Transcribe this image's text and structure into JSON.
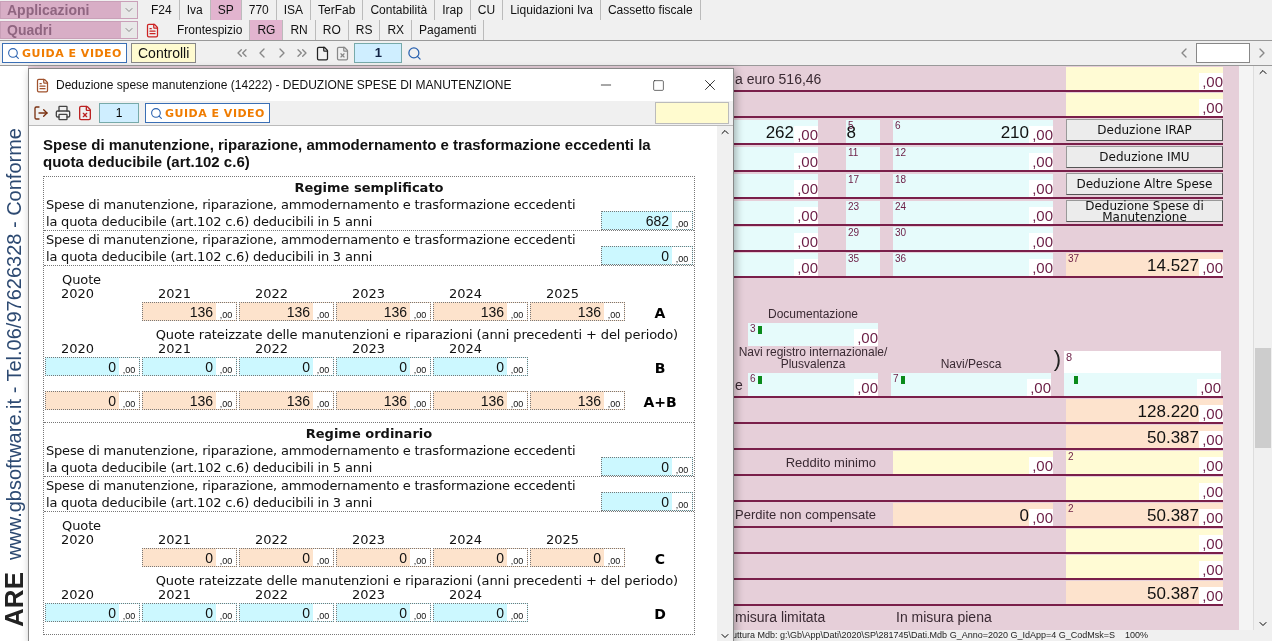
{
  "menu": {
    "apps_label": "Applicazioni",
    "apps_tabs": [
      {
        "label": "F24",
        "selected": false
      },
      {
        "label": "Iva",
        "selected": false
      },
      {
        "label": "SP",
        "selected": true
      },
      {
        "label": "770",
        "selected": false
      },
      {
        "label": "ISA",
        "selected": false
      },
      {
        "label": "TerFab",
        "selected": false
      },
      {
        "label": "Contabilità",
        "selected": false
      },
      {
        "label": "Irap",
        "selected": false
      },
      {
        "label": "CU",
        "selected": false
      },
      {
        "label": "Liquidazioni Iva",
        "selected": false
      },
      {
        "label": "Cassetto fiscale",
        "selected": false
      }
    ],
    "sheets_label": "Quadri",
    "sheet_tabs": [
      {
        "label": "Frontespizio",
        "selected": false
      },
      {
        "label": "RG",
        "selected": true
      },
      {
        "label": "RN",
        "selected": false
      },
      {
        "label": "RO",
        "selected": false
      },
      {
        "label": "RS",
        "selected": false
      },
      {
        "label": "RX",
        "selected": false
      },
      {
        "label": "Pagamenti",
        "selected": false
      }
    ]
  },
  "toolbar": {
    "guide": "GUIDA E VIDEO",
    "controls": "Controlli",
    "page": "1"
  },
  "side_strip": {
    "text": "www.gbsoftware.it - Tel.06/97626328 - Conforme",
    "logo": "ARE"
  },
  "form": {
    "upper_rows": [
      {
        "cells": [
          {
            "kind": "text",
            "text": "a euro 516,46"
          },
          "",
          "",
          {
            "kind": "note",
            "cents": ",00"
          }
        ]
      },
      {
        "cells": [
          "",
          "",
          "",
          {
            "kind": "note",
            "cents": ",00"
          }
        ]
      },
      {
        "cells": [
          {
            "kind": "input",
            "value": "262",
            "cents": ",00"
          },
          {
            "kind": "input",
            "tag": "5",
            "value": "8"
          },
          {
            "kind": "input",
            "tag": "6",
            "value": "210",
            "cents": ",00"
          },
          {
            "kind": "button",
            "text": "Deduzione IRAP"
          }
        ]
      },
      {
        "cells": [
          {
            "kind": "input",
            "cents": ",00"
          },
          {
            "kind": "input",
            "tag": "11"
          },
          {
            "kind": "input",
            "tag": "12",
            "cents": ",00"
          },
          {
            "kind": "button",
            "text": "Deduzione IMU"
          }
        ]
      },
      {
        "cells": [
          {
            "kind": "input",
            "cents": ",00"
          },
          {
            "kind": "input",
            "tag": "17"
          },
          {
            "kind": "input",
            "tag": "18",
            "cents": ",00"
          },
          {
            "kind": "button",
            "text": "Deduzione Altre Spese"
          }
        ]
      },
      {
        "cells": [
          {
            "kind": "input",
            "cents": ",00"
          },
          {
            "kind": "input",
            "tag": "23"
          },
          {
            "kind": "input",
            "tag": "24",
            "cents": ",00"
          },
          {
            "kind": "button",
            "text": "Deduzione Spese di Manutenzione"
          }
        ]
      },
      {
        "cells": [
          {
            "kind": "input",
            "cents": ",00"
          },
          {
            "kind": "input",
            "tag": "29"
          },
          {
            "kind": "input",
            "tag": "30",
            "cents": ",00"
          },
          ""
        ]
      },
      {
        "cells": [
          {
            "kind": "input",
            "cents": ",00"
          },
          {
            "kind": "input",
            "tag": "35"
          },
          {
            "kind": "input",
            "tag": "36",
            "cents": ",00"
          },
          {
            "kind": "total",
            "tag": "37",
            "value": "14.527",
            "cents": ",00"
          }
        ]
      }
    ],
    "documentation": {
      "label": "Documentazione",
      "tag": "3",
      "marker": true,
      "cents": ",00"
    },
    "ships": {
      "prefix": "e",
      "fields": [
        {
          "label": "Navi registro internazionale/ Plusvalenza",
          "tag": "6",
          "marker": true,
          "cents": ",00"
        },
        {
          "label": "Navi/Pesca",
          "tag": "7",
          "marker": true,
          "cents": ",00"
        }
      ],
      "bracket": ")",
      "box": {
        "tag": "8",
        "marker": true,
        "cents": ",00"
      }
    },
    "lower_rows": [
      {
        "cells": [
          "",
          "",
          "",
          {
            "kind": "total",
            "value": "128.220",
            "cents": ",00"
          }
        ]
      },
      {
        "cells": [
          "",
          "",
          "",
          {
            "kind": "total",
            "value": "50.387",
            "cents": ",00"
          }
        ]
      },
      {
        "cells": [
          {
            "kind": "label",
            "text": "Reddito minimo"
          },
          "",
          {
            "kind": "note",
            "cents": ",00"
          },
          {
            "kind": "note",
            "tag": "2",
            "cents": ",00"
          }
        ]
      },
      {
        "cells": [
          "",
          "",
          "",
          {
            "kind": "note",
            "cents": ",00"
          }
        ]
      },
      {
        "cells": [
          {
            "kind": "label",
            "text": "Perdite non compensate"
          },
          "",
          {
            "kind": "total",
            "value": "0",
            "cents": ",00"
          },
          {
            "kind": "total",
            "tag": "2",
            "value": "50.387",
            "cents": ",00"
          }
        ]
      },
      {
        "cells": [
          "",
          "",
          "",
          {
            "kind": "note",
            "cents": ",00"
          }
        ]
      },
      {
        "cells": [
          "",
          "",
          "",
          {
            "kind": "note",
            "cents": ",00"
          }
        ]
      },
      {
        "cells": [
          "",
          "",
          "",
          {
            "kind": "total",
            "value": "50.387",
            "cents": ",00"
          }
        ]
      }
    ],
    "footer": [
      "misura limitata",
      "In misura piena"
    ]
  },
  "status_bar": {
    "path": "uttura Mdb: g:\\Gb\\App\\Dati\\2020\\SP\\281745\\Dati.Mdb G_Anno=2020 G_IdApp=4 G_CodMsk=S",
    "zoom": "100%"
  },
  "dialog": {
    "title": "Deduzione spese manutenzione (14222) - DEDUZIONE SPESE DI MANUTENZIONE",
    "page": "1",
    "guide": "GUIDA E VIDEO",
    "heading": "Spese di manutenzione, riparazione, ammodernamento e trasformazione eccedenti la\nquota deducibile (art.102 c.6)",
    "sections": [
      {
        "title": "Regime semplificato",
        "amounts": [
          {
            "label": "Spese di manutenzione, riparazione, ammodernamento e trasformazione eccedenti\nla quota deducibile (art.102 c.6) deducibili in 5 anni",
            "value": "682",
            "cents": ",00"
          },
          {
            "label": "Spese di manutenzione, riparazione, ammodernamento e trasformazione eccedenti\nla quota deducibile (art.102 c.6) deducibili in 3 anni",
            "value": "0",
            "cents": ",00"
          }
        ],
        "blocks": [
          {
            "kind": "quotes",
            "caption": "Quote",
            "years": [
              "2020",
              "2021",
              "2022",
              "2023",
              "2024",
              "2025"
            ],
            "letter": "A",
            "cells": [
              {
                "kind": "blank"
              },
              {
                "kind": "total",
                "value": "136",
                "cents": ",00"
              },
              {
                "kind": "total",
                "value": "136",
                "cents": ",00"
              },
              {
                "kind": "total",
                "value": "136",
                "cents": ",00"
              },
              {
                "kind": "total",
                "value": "136",
                "cents": ",00"
              },
              {
                "kind": "total",
                "value": "136",
                "cents": ",00"
              }
            ]
          },
          {
            "kind": "installments",
            "caption": "Quote rateizzate delle manutenzioni e riparazioni (anni precedenti + del periodo)",
            "years": [
              "2020",
              "2021",
              "2022",
              "2023",
              "2024"
            ],
            "letter": "B",
            "cells": [
              {
                "kind": "input",
                "value": "0",
                "cents": ",00"
              },
              {
                "kind": "input",
                "value": "0",
                "cents": ",00"
              },
              {
                "kind": "input",
                "value": "0",
                "cents": ",00"
              },
              {
                "kind": "input",
                "value": "0",
                "cents": ",00"
              },
              {
                "kind": "input",
                "value": "0",
                "cents": ",00"
              }
            ]
          },
          {
            "kind": "sum",
            "letter": "A+B",
            "cells": [
              {
                "kind": "total",
                "value": "0",
                "cents": ",00"
              },
              {
                "kind": "total",
                "value": "136",
                "cents": ",00"
              },
              {
                "kind": "total",
                "value": "136",
                "cents": ",00"
              },
              {
                "kind": "total",
                "value": "136",
                "cents": ",00"
              },
              {
                "kind": "total",
                "value": "136",
                "cents": ",00"
              },
              {
                "kind": "total",
                "value": "136",
                "cents": ",00"
              }
            ]
          }
        ]
      },
      {
        "title": "Regime ordinario",
        "amounts": [
          {
            "label": "Spese di manutenzione, riparazione, ammodernamento e trasformazione eccedenti\nla quota deducibile (art.102 c.6) deducibili in 5 anni",
            "value": "0",
            "cents": ",00"
          },
          {
            "label": "Spese di manutenzione, riparazione, ammodernamento e trasformazione eccedenti\nla quota deducibile (art.102 c.6) deducibili in 3 anni",
            "value": "0",
            "cents": ",00"
          }
        ],
        "blocks": [
          {
            "kind": "quotes",
            "caption": "Quote",
            "years": [
              "2020",
              "2021",
              "2022",
              "2023",
              "2024",
              "2025"
            ],
            "letter": "C",
            "cells": [
              {
                "kind": "blank"
              },
              {
                "kind": "total",
                "value": "0",
                "cents": ",00"
              },
              {
                "kind": "total",
                "value": "0",
                "cents": ",00"
              },
              {
                "kind": "total",
                "value": "0",
                "cents": ",00"
              },
              {
                "kind": "total",
                "value": "0",
                "cents": ",00"
              },
              {
                "kind": "total",
                "value": "0",
                "cents": ",00"
              }
            ]
          },
          {
            "kind": "installments",
            "caption": "Quote rateizzate delle manutenzioni e riparazioni (anni precedenti + del periodo)",
            "years": [
              "2020",
              "2021",
              "2022",
              "2023",
              "2024"
            ],
            "letter": "D",
            "cells": [
              {
                "kind": "input",
                "value": "0",
                "cents": ",00"
              },
              {
                "kind": "input",
                "value": "0",
                "cents": ",00"
              },
              {
                "kind": "input",
                "value": "0",
                "cents": ",00"
              },
              {
                "kind": "input",
                "value": "0",
                "cents": ",00"
              },
              {
                "kind": "input",
                "value": "0",
                "cents": ",00"
              }
            ]
          }
        ]
      }
    ]
  }
}
